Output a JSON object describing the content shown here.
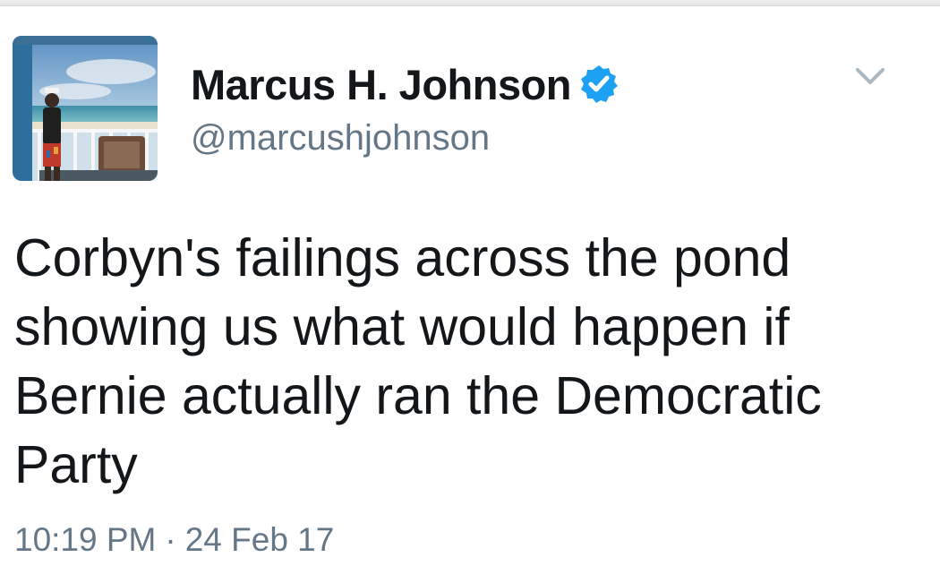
{
  "tweet": {
    "display_name": "Marcus H. Johnson",
    "handle": "@marcushjohnson",
    "verified": true,
    "text": "Corbyn's failings across the pond\nshowing us what would happen if\nBernie actually ran the Democratic\nParty",
    "time": "10:19 PM",
    "separator": "·",
    "date": "24 Feb 17"
  },
  "icons": {
    "verified_badge": "verified-badge-icon",
    "menu_caret": "chevron-down-icon"
  },
  "colors": {
    "text_primary": "#14171a",
    "text_secondary": "#657786",
    "verified_blue": "#1da1f2",
    "caret_gray": "#aab8c2"
  }
}
